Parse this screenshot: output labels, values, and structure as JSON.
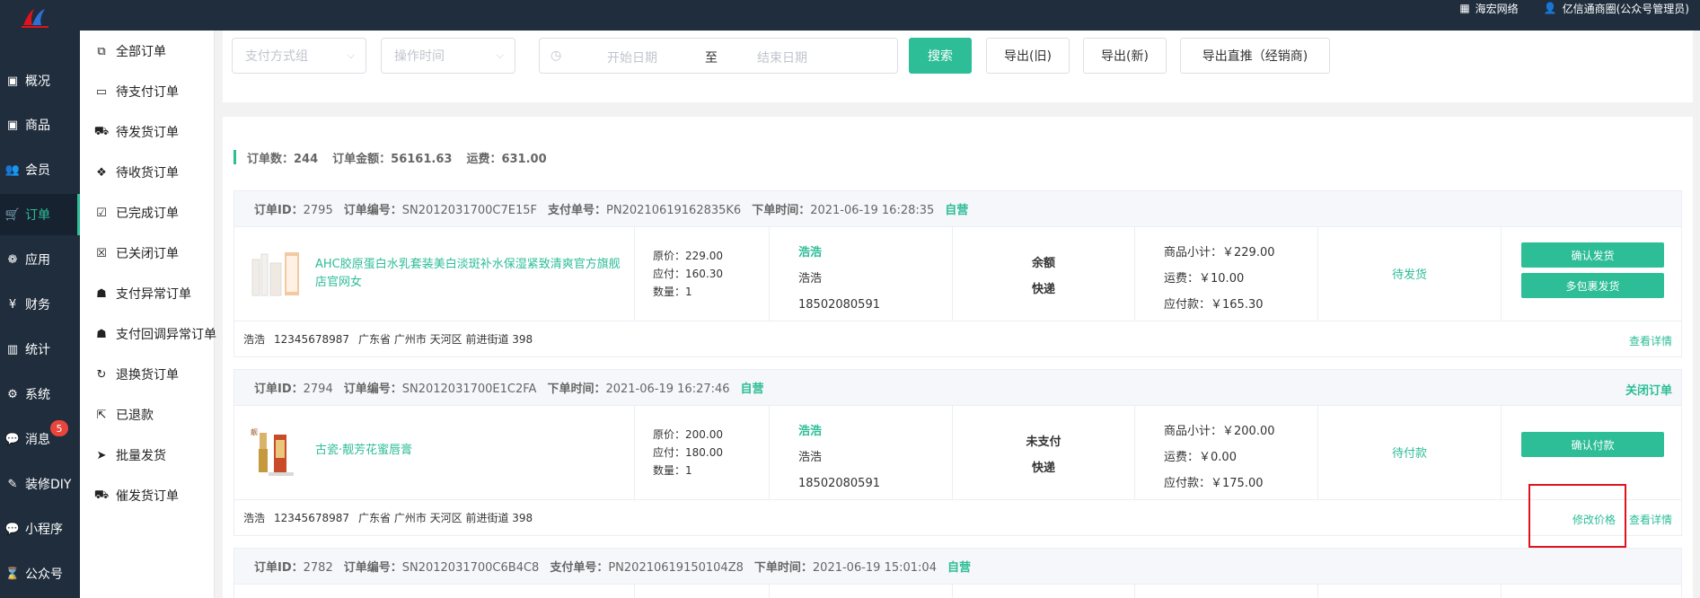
{
  "topbar": {
    "brand_icon": "logo",
    "company": "海宏网络",
    "user": "亿信通商圈(公众号管理员)"
  },
  "sidebar": {
    "items": [
      {
        "label": "概况",
        "icon": "dashboard-icon"
      },
      {
        "label": "商品",
        "icon": "goods-icon"
      },
      {
        "label": "会员",
        "icon": "members-icon"
      },
      {
        "label": "订单",
        "icon": "cart-icon"
      },
      {
        "label": "应用",
        "icon": "apps-icon"
      },
      {
        "label": "财务",
        "icon": "yen-icon"
      },
      {
        "label": "统计",
        "icon": "stats-icon"
      },
      {
        "label": "系统",
        "icon": "settings-icon"
      },
      {
        "label": "消息",
        "icon": "message-icon"
      },
      {
        "label": "装修DIY",
        "icon": "brush-icon"
      },
      {
        "label": "小程序",
        "icon": "wechat-icon"
      },
      {
        "label": "公众号",
        "icon": "hourglass-icon"
      }
    ],
    "message_badge": "5"
  },
  "submenu": {
    "items": [
      "全部订单",
      "待支付订单",
      "待发货订单",
      "待收货订单",
      "已完成订单",
      "已关闭订单",
      "支付异常订单",
      "支付回调异常订单",
      "退换货订单",
      "已退款",
      "批量发货",
      "催发货订单"
    ]
  },
  "filters": {
    "payment_placeholder": "支付方式组",
    "time_placeholder": "操作时间",
    "start_placeholder": "开始日期",
    "range_sep": "至",
    "end_placeholder": "结束日期",
    "search": "搜索",
    "export_old": "导出(旧)",
    "export_new": "导出(新)",
    "export_direct": "导出直推（经销商)"
  },
  "summary": {
    "count_label": "订单数：",
    "count": "244",
    "amount_label": "订单金额：",
    "amount": "56161.63",
    "freight_label": "运费：",
    "freight": "631.00"
  },
  "labels": {
    "order_id": "订单ID：",
    "order_no": "订单编号：",
    "pay_no": "支付单号：",
    "order_time": "下单时间：",
    "self": "自营",
    "original": "原价：",
    "payable": "应付：",
    "qty": "数量：",
    "subtotal": "商品小计：",
    "shipping": "运费：",
    "due": "应付款：",
    "view_detail": "查看详情",
    "modify_price": "修改价格",
    "close_order": "关闭订单"
  },
  "orders": [
    {
      "id": "2795",
      "no": "SN2012031700C7E15F",
      "pay_no": "PN20210619162835K6",
      "time": "2021-06-19 16:28:35",
      "product": "AHC胶原蛋白水乳套装美白淡斑补水保湿紧致清爽官方旗舰店官网女",
      "original": "229.00",
      "payable": "160.30",
      "qty": "1",
      "buyer_name": "浩浩",
      "receiver": "浩浩",
      "phone": "18502080591",
      "pay_method": "余额",
      "delivery": "快递",
      "subtotal": "￥229.00",
      "shipping": "￥10.00",
      "due": "￥165.30",
      "status": "待发货",
      "actions": [
        "确认发货",
        "多包裹发货"
      ],
      "addr_name": "浩浩",
      "addr_phone": "12345678987",
      "addr": "广东省 广州市 天河区 前进街道 398"
    },
    {
      "id": "2794",
      "no": "SN2012031700E1C2FA",
      "time": "2021-06-19 16:27:46",
      "product": "古瓷·靓芳花蜜唇膏",
      "original": "200.00",
      "payable": "180.00",
      "qty": "1",
      "buyer_name": "浩浩",
      "receiver": "浩浩",
      "phone": "18502080591",
      "pay_method": "未支付",
      "delivery": "快递",
      "subtotal": "￥200.00",
      "shipping": "￥0.00",
      "due": "￥175.00",
      "status": "待付款",
      "actions": [
        "确认付款"
      ],
      "addr_name": "浩浩",
      "addr_phone": "12345678987",
      "addr": "广东省 广州市 天河区 前进街道 398"
    },
    {
      "id": "2782",
      "no": "SN2012031700C6B4C8",
      "pay_no": "PN20210619150104Z8",
      "time": "2021-06-19 15:01:04"
    }
  ]
}
